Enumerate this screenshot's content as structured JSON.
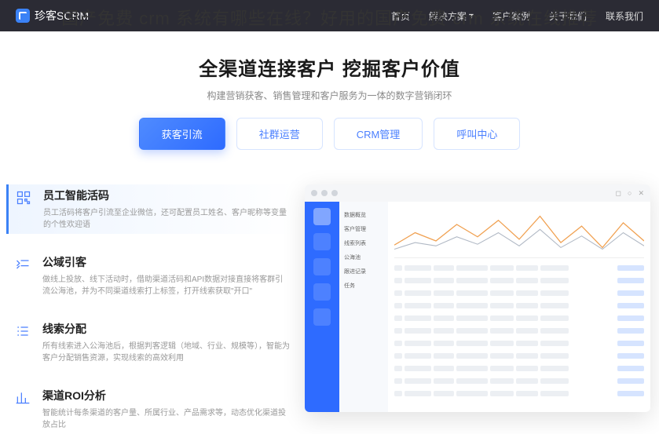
{
  "overlay_title": "国产免费 crm 系统有哪些在线？好用的国产免费 crm 系统在线推荐",
  "topbar": {
    "brand": "珍客SCRM",
    "nav": [
      "首页",
      "解决方案",
      "客户案例",
      "关于我们",
      "联系我们"
    ]
  },
  "hero": {
    "title": "全渠道连接客户 挖掘客户价值",
    "subtitle": "构建营销获客、销售管理和客户服务为一体的数字营销闭环"
  },
  "tabs": [
    {
      "label": "获客引流",
      "active": true
    },
    {
      "label": "社群运营",
      "active": false
    },
    {
      "label": "CRM管理",
      "active": false
    },
    {
      "label": "呼叫中心",
      "active": false
    }
  ],
  "features": [
    {
      "icon": "qr",
      "title": "员工智能活码",
      "desc": "员工活码将客户引流至企业微信，还可配置员工姓名、客户昵称等变量的个性欢迎语",
      "selected": true
    },
    {
      "icon": "flow",
      "title": "公域引客",
      "desc": "做线上投放、线下活动时，借助渠道活码和API数据对接直接将客群引流公海池，并为不同渠道线索打上标签，打开线索获取\"开口\"",
      "selected": false
    },
    {
      "icon": "list",
      "title": "线索分配",
      "desc": "所有线索进入公海池后，根据判客逻辑（地域、行业、规模等），智能为客户分配销售资源，实现线索的高效利用",
      "selected": false
    },
    {
      "icon": "chart",
      "title": "渠道ROI分析",
      "desc": "智能统计每条渠道的客户量、所属行业、产品需求等，动态优化渠道投放占比",
      "selected": false
    }
  ],
  "mock": {
    "sub_items": [
      "数据概览",
      "客户管理",
      "线索列表",
      "公海池",
      "跟进记录",
      "任务"
    ],
    "win_ctrl": [
      "◻",
      "○",
      "✕"
    ]
  }
}
